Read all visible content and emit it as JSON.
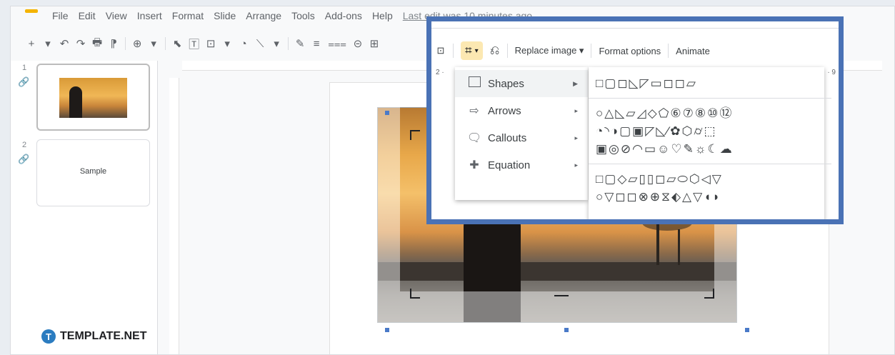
{
  "menubar": {
    "items": [
      "File",
      "Edit",
      "View",
      "Insert",
      "Format",
      "Slide",
      "Arrange",
      "Tools",
      "Add-ons",
      "Help"
    ],
    "last_edit": "Last edit was 10 minutes ago"
  },
  "toolbar": {
    "icons": [
      "+",
      "▾",
      "↶",
      "↷",
      "🖶",
      "⁋",
      "⊕",
      "▾",
      "⬉",
      "🅃",
      "⊡",
      "▾",
      "◔",
      "⟍",
      "▾",
      "✎",
      "≡",
      "⩶",
      "⊝",
      "⊞"
    ]
  },
  "filmstrip": {
    "slides": [
      {
        "number": "1",
        "text": ""
      },
      {
        "number": "2",
        "text": "Sample"
      }
    ]
  },
  "image_toolbar": {
    "replace_image_label": "Replace image ▾",
    "format_options_label": "Format options",
    "animate_label": "Animate",
    "ruler_left": "2 ·",
    "ruler_right": "· 9"
  },
  "mask_menu": {
    "items": [
      {
        "label": "Shapes",
        "icon": "square-icon",
        "arrow": "▶"
      },
      {
        "label": "Arrows",
        "icon": "arrow-icon",
        "arrow": "▸"
      },
      {
        "label": "Callouts",
        "icon": "callout-icon",
        "arrow": "▸"
      },
      {
        "label": "Equation",
        "icon": "plus-icon",
        "arrow": "▸"
      }
    ]
  },
  "shapes_submenu": {
    "row1": "□▢◻◺◸▭◻◻▱",
    "row2": "○△◺▱◿◇⬠⑥⑦⑧⑩⑫",
    "row3": "◔◝◑▢▣◸◺⁄✿⬡⌭⬚",
    "row4": "▣◎⊘◠▭☺♡✎☼☾☁",
    "row5": "□▢◇▱▯▯◻▱⬭⬡◁▽",
    "row6": "○▽◻◻⊗⊕⧖⬖△▽◖◗"
  },
  "brand": {
    "name": "TEMPLATE.NET",
    "badge": "T"
  }
}
